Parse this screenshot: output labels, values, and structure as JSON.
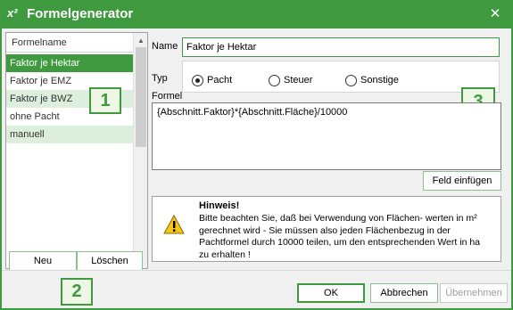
{
  "window": {
    "title": "Formelgenerator",
    "close_glyph": "✕"
  },
  "list": {
    "header": "Formelname",
    "items": [
      {
        "label": "Faktor je Hektar",
        "state": "selected"
      },
      {
        "label": "Faktor je EMZ",
        "state": "normal"
      },
      {
        "label": "Faktor je BWZ",
        "state": "highlight"
      },
      {
        "label": "ohne Pacht",
        "state": "normal"
      },
      {
        "label": "manuell",
        "state": "highlight"
      }
    ]
  },
  "buttons": {
    "neu": "Neu",
    "loeschen": "Löschen",
    "feld_einfuegen": "Feld einfügen",
    "ok": "OK",
    "abbrechen": "Abbrechen",
    "uebernehmen": "Übernehmen"
  },
  "form": {
    "name_label": "Name",
    "name_value": "Faktor je Hektar",
    "typ_label": "Typ",
    "typ_options": [
      "Pacht",
      "Steuer",
      "Sonstige"
    ],
    "typ_selected": "Pacht",
    "formel_label": "Formel",
    "formel_value": "{Abschnitt.Faktor}*{Abschnitt.Fläche}/10000"
  },
  "hint": {
    "title": "Hinweis!",
    "lines": [
      "Bitte beachten Sie, daß bei Verwendung von Flächen- werten in m²",
      "gerechnet wird - Sie müssen also jeden Flächenbezug in der",
      "Pachtformel durch 10000 teilen, um den entsprechenden Wert in ha",
      "zu erhalten !"
    ],
    "icon": "warning-icon"
  },
  "badges": {
    "one": "1",
    "two": "2",
    "three": "3"
  },
  "colors": {
    "accent": "#3f9a3f",
    "selected_bg": "#3f9a3f",
    "highlight_bg": "#dcefdc",
    "badge_bg": "#eef6e6"
  }
}
